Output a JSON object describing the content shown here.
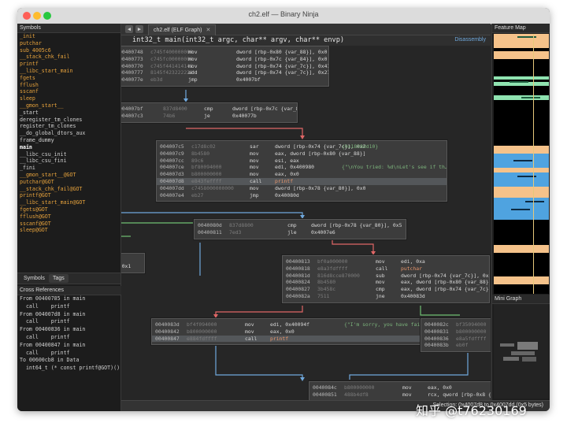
{
  "window": {
    "title": "ch2.elf — Binary Ninja",
    "traffic_lights": [
      "#fe5f57",
      "#febc2e",
      "#28c840"
    ]
  },
  "sidebar": {
    "symbols_header": "Symbols",
    "symbols": [
      {
        "name": "_init",
        "kind": "import"
      },
      {
        "name": "putchar",
        "kind": "import"
      },
      {
        "name": "sub_4005c6",
        "kind": "import"
      },
      {
        "name": "__stack_chk_fail",
        "kind": "import"
      },
      {
        "name": "printf",
        "kind": "import"
      },
      {
        "name": "__libc_start_main",
        "kind": "import"
      },
      {
        "name": "fgets",
        "kind": "import"
      },
      {
        "name": "fflush",
        "kind": "import"
      },
      {
        "name": "sscanf",
        "kind": "import"
      },
      {
        "name": "sleep",
        "kind": "import"
      },
      {
        "name": "__gmon_start__",
        "kind": "import"
      },
      {
        "name": "_start",
        "kind": "func"
      },
      {
        "name": "deregister_tm_clones",
        "kind": "func"
      },
      {
        "name": "register_tm_clones",
        "kind": "func"
      },
      {
        "name": "__do_global_dtors_aux",
        "kind": "func"
      },
      {
        "name": "frame_dummy",
        "kind": "func"
      },
      {
        "name": "main",
        "kind": "selected"
      },
      {
        "name": "__libc_csu_init",
        "kind": "func"
      },
      {
        "name": "__libc_csu_fini",
        "kind": "func"
      },
      {
        "name": "_fini",
        "kind": "func"
      },
      {
        "name": "__gmon_start__@GOT",
        "kind": "import"
      },
      {
        "name": "putchar@GOT",
        "kind": "import"
      },
      {
        "name": "__stack_chk_fail@GOT",
        "kind": "import"
      },
      {
        "name": "printf@GOT",
        "kind": "import"
      },
      {
        "name": "__libc_start_main@GOT",
        "kind": "import"
      },
      {
        "name": "fgets@GOT",
        "kind": "import"
      },
      {
        "name": "fflush@GOT",
        "kind": "import"
      },
      {
        "name": "sscanf@GOT",
        "kind": "import"
      },
      {
        "name": "sleep@GOT",
        "kind": "import"
      }
    ],
    "tabs": [
      "Symbols",
      "Tags"
    ],
    "xref_header": "Cross References",
    "xrefs": [
      {
        "text": "From 00400785 in main"
      },
      {
        "text": "  call    printf"
      },
      {
        "text": "From 004007d8 in main"
      },
      {
        "text": "  call    printf"
      },
      {
        "text": "From 00400836 in main"
      },
      {
        "text": "  call    printf"
      },
      {
        "text": "From 00400847 in main"
      },
      {
        "text": "  call    printf"
      },
      {
        "text": "To 00600cb8 in Data"
      },
      {
        "text": "  int64_t (* const printf@GOT)()"
      }
    ]
  },
  "tabbar": {
    "back": "◀",
    "forward": "▶",
    "tab_label": "ch2.elf (ELF Graph)",
    "close": "✕"
  },
  "function_header": {
    "signature": "int32_t main(int32_t argc, char** argv, char** envp)",
    "view_mode": "Disassembly"
  },
  "blocks": [
    {
      "id": "b1",
      "lines": [
        [
          "00400748",
          "c745f400000000",
          "mov",
          "dword [rbp-0x80 {var_88}], 0x0",
          "",
          false
        ],
        [
          "00400773",
          "c745fc00000000",
          "mov",
          "dword [rbp-0x7c {var_84}], 0x0",
          "",
          false
        ],
        [
          "00400770",
          "c745f441414141",
          "mov",
          "dword [rbp-0x74 {var_7c}], 0x41414141",
          "",
          false
        ],
        [
          "00400777",
          "8145f423222221",
          "add",
          "dword [rbp-0x74 {var_7c}], 0x21223380",
          "{0x62637441}",
          false
        ],
        [
          "0040077e",
          "eb3d",
          "jmp",
          "0x4007bf",
          "",
          false
        ]
      ]
    },
    {
      "id": "b2",
      "lines": [
        [
          "004007bf",
          "837d8400",
          "cmp",
          "dword [rbp-0x7c {var_84}], 0x0",
          "",
          false
        ],
        [
          "004007c3",
          "74b6",
          "je",
          "0x40077b",
          "",
          false
        ]
      ]
    },
    {
      "id": "b3",
      "lines": [
        [
          "004007c5",
          "c17d8c02",
          "sar",
          "dword [rbp-0x74 {var_7c}], 0x2",
          "{0x1898dd10}",
          false
        ],
        [
          "004007c9",
          "8b4580",
          "mov",
          "eax, dword [rbp-0x80 {var_88}]",
          "",
          false
        ],
        [
          "004007cc",
          "89c6",
          "mov",
          "esi, eax",
          "",
          false
        ],
        [
          "004007ce",
          "bf80094000",
          "mov",
          "edi, 0x400980",
          "{\"\\nYou tried: %d\\nLet's see if th…\"}",
          false
        ],
        [
          "004007d3",
          "b800000000",
          "mov",
          "eax, 0x0",
          "",
          false
        ],
        [
          "004007d8",
          "e843feffff",
          "call",
          "printf",
          "",
          true
        ],
        [
          "004007dd",
          "c7458000000000",
          "mov",
          "dword [rbp-0x78 {var_80}], 0x0",
          "",
          false
        ],
        [
          "004007e4",
          "eb27",
          "jmp",
          "0x40080d",
          "",
          false
        ]
      ]
    },
    {
      "id": "b4",
      "lines": [
        [
          "0040080d",
          "837d8800",
          "cmp",
          "dword [rbp-0x78 {var_80}], 0x5",
          "",
          false
        ],
        [
          "00400811",
          "7ed3",
          "jle",
          "0x4007e6",
          "",
          false
        ]
      ]
    },
    {
      "id": "b5",
      "lines": [
        [
          "00400813",
          "bf0a000000",
          "mov",
          "edi, 0xa",
          "",
          false
        ],
        [
          "00400818",
          "e8a3fdffff",
          "call",
          "putchar",
          "",
          false
        ],
        [
          "0040081d",
          "816d8cce870000",
          "sub",
          "dword [rbp-0x74 {var_7c}], 0x87ce",
          "",
          false
        ],
        [
          "00400824",
          "8b4580",
          "mov",
          "eax, dword [rbp-0x80 {var_88}]",
          "",
          false
        ],
        [
          "00400827",
          "3b458c",
          "cmp",
          "eax, dword [rbp-0x74 {var_7c}]",
          "",
          false
        ],
        [
          "0040082a",
          "7511",
          "jne",
          "0x40083d",
          "",
          false
        ]
      ]
    },
    {
      "id": "b6",
      "lines": [
        [
          "0040083d",
          "bf4f094000",
          "mov",
          "edi, 0x40094f",
          "{\"I'm sorry, you have failed.\"}",
          false
        ],
        [
          "00400842",
          "b800000000",
          "mov",
          "eax, 0x0",
          "",
          false
        ],
        [
          "00400847",
          "e884fdffff",
          "call",
          "printf",
          "",
          true
        ]
      ]
    },
    {
      "id": "b7",
      "lines": [
        [
          "0040082c",
          "bf35094000",
          "mov",
          "edi, 0x400935",
          "",
          false
        ],
        [
          "00400831",
          "b800000000",
          "mov",
          "eax, 0x0",
          "",
          false
        ],
        [
          "00400836",
          "e8a5fdffff",
          "call",
          "printf",
          "",
          false
        ],
        [
          "0040083b",
          "eb0f",
          "jmp",
          "0x40084c",
          "",
          false
        ]
      ]
    },
    {
      "id": "b8",
      "lines": [
        [
          "0040084c",
          "b800000000",
          "mov",
          "eax, 0x0",
          "",
          false
        ],
        [
          "00400851",
          "488b4df8",
          "mov",
          "rcx, qword [rbp-0x8 {var_10}]",
          "",
          false
        ]
      ]
    },
    {
      "id": "b9",
      "lines": [
        [
          "0040077b",
          "",
          "",
          "",
          "",
          false
        ],
        [
          "00400780",
          "",
          "",
          ", 0x1",
          "",
          false
        ]
      ]
    }
  ],
  "status": {
    "selection": "Selection: 0x4007d8 to 0x4007dd (0x5 bytes)"
  },
  "rightpanel": {
    "feature_map_title": "Feature Map",
    "mini_graph_title": "Mini Graph"
  },
  "watermark": "知乎 @t76230169",
  "colors": {
    "address": "#b9b9b9",
    "bytes": "#7d7d7d",
    "mnemonic": "#d8d8d8",
    "comment": "#7cb37c",
    "call_target": "#e8966c",
    "import_symbol": "#e6a23c",
    "edge_blue": "#6fa8dc",
    "edge_green": "#6fbf73",
    "edge_red": "#e06666",
    "feature_blue": "#4fa3e0",
    "feature_orange": "#f5c28a",
    "feature_green": "#8fe3b0"
  }
}
